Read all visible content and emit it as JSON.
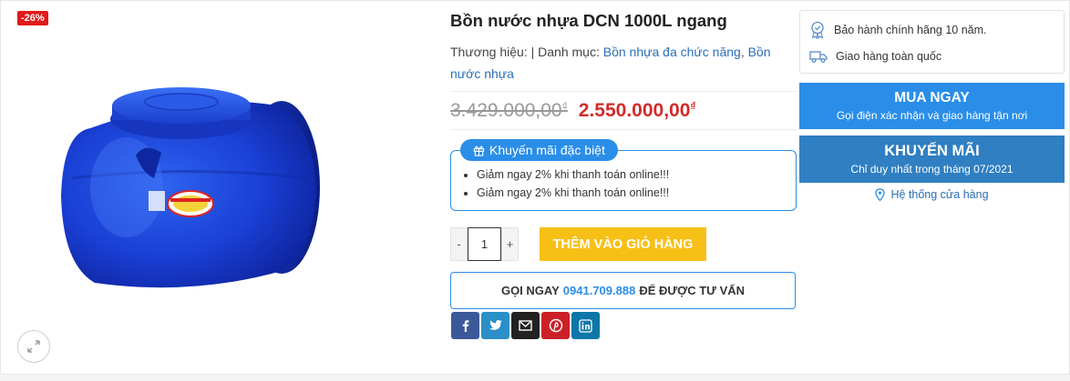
{
  "gallery": {
    "sale_badge": "-26%"
  },
  "product": {
    "title": "Bồn nước nhựa DCN 1000L ngang",
    "brand_label": "Thương hiệu:",
    "separator": "|",
    "category_label": "Danh mục:",
    "categories": [
      "Bồn nhựa đa chức năng",
      "Bồn nước nhựa"
    ],
    "category_comma": ",",
    "old_price": "3.429.000,00",
    "new_price": "2.550.000,00",
    "currency": "₫"
  },
  "promo": {
    "title": "Khuyến mãi đặc biệt",
    "items": [
      "Giảm ngay 2% khi thanh toán online!!!",
      "Giảm ngay 2% khi thanh toán online!!!"
    ]
  },
  "cart": {
    "minus": "-",
    "quantity": "1",
    "plus": "+",
    "add_label": "THÊM VÀO GIỎ HÀNG"
  },
  "call": {
    "prefix": "GỌI NGAY",
    "phone": "0941.709.888",
    "suffix": "ĐỂ ĐƯỢC TƯ VẤN"
  },
  "share": [
    {
      "name": "facebook-icon",
      "color": "#3b5998"
    },
    {
      "name": "twitter-icon",
      "color": "#2b8fc7"
    },
    {
      "name": "email-icon",
      "color": "#222222"
    },
    {
      "name": "pinterest-icon",
      "color": "#cb2027"
    },
    {
      "name": "linkedin-icon",
      "color": "#0e76a8"
    }
  ],
  "sidebar": {
    "benefits": [
      {
        "icon": "warranty-badge-icon",
        "text": "Bảo hành chính hãng 10 năm."
      },
      {
        "icon": "truck-icon",
        "text": "Giao hàng toàn quốc"
      }
    ],
    "buy_now": {
      "title": "MUA NGAY",
      "subtitle": "Gọi điện xác nhận và giao hàng tận nơi"
    },
    "promotion": {
      "title": "KHUYẾN MÃI",
      "subtitle": "Chỉ duy nhất trong tháng 07/2021"
    },
    "store_link": "Hệ thống cửa hàng"
  },
  "colors": {
    "accent_blue": "#2a8ee8",
    "price_red": "#d12b2b",
    "cart_yellow": "#f7c017",
    "badge_red": "#e21a1a"
  }
}
